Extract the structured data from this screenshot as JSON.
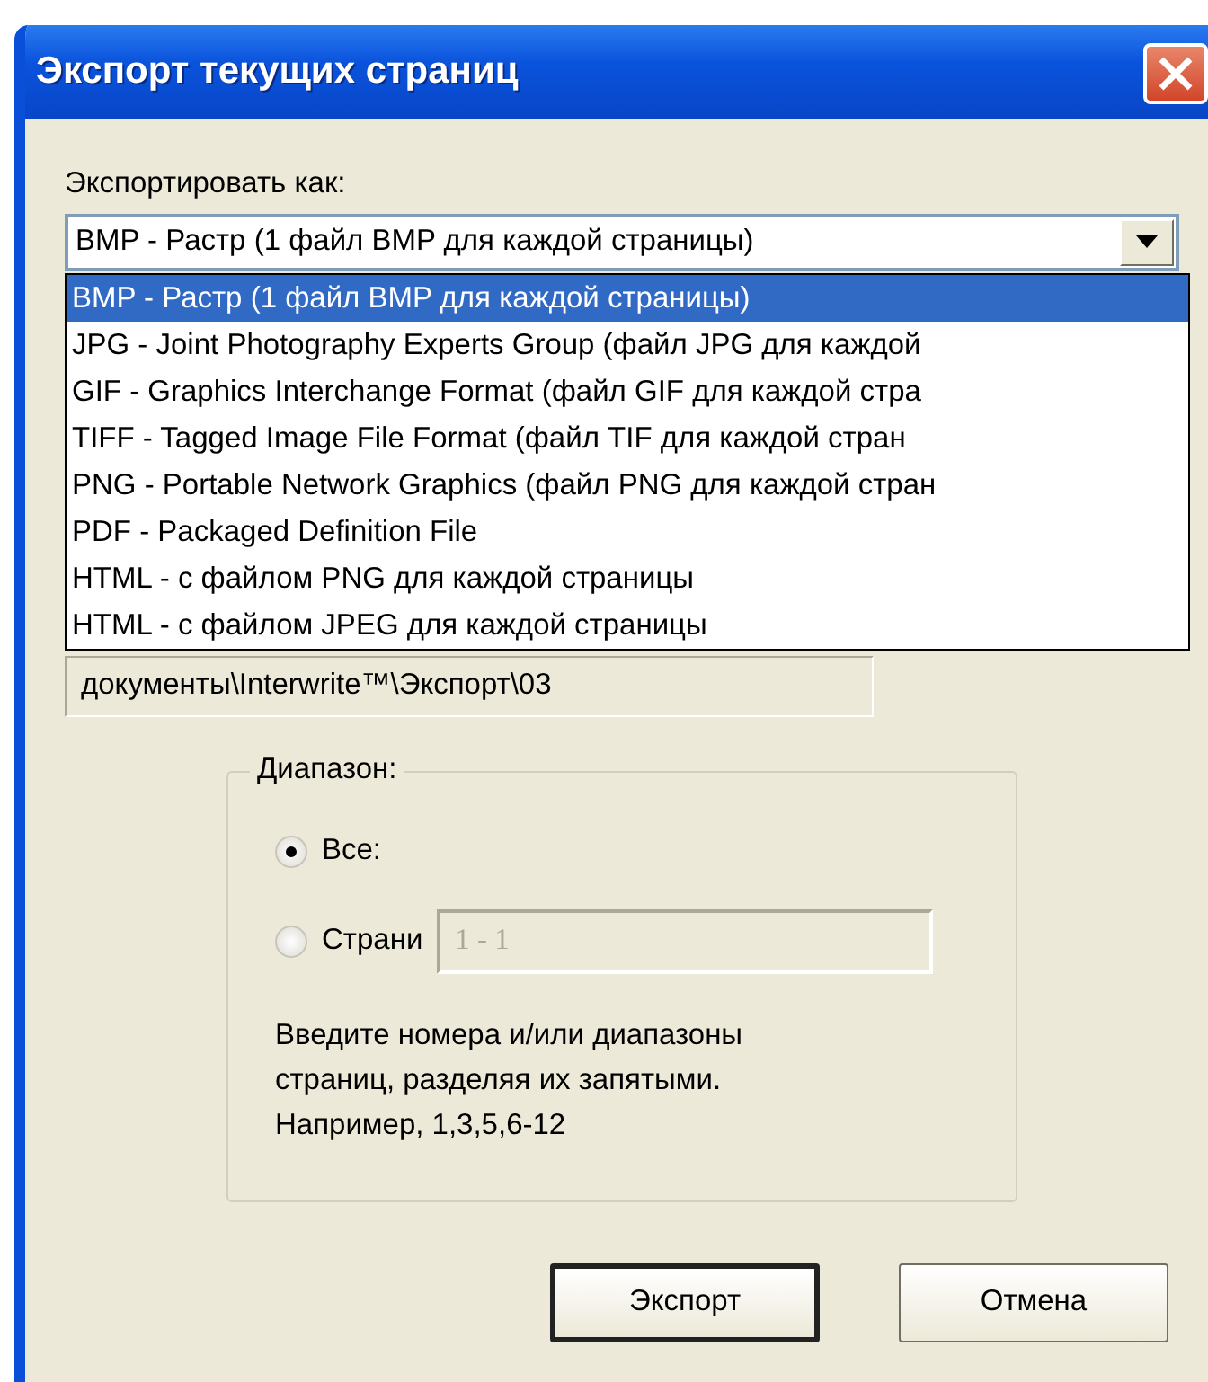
{
  "window": {
    "title": "Экспорт текущих страниц"
  },
  "export_as": {
    "label": "Экспортировать как:",
    "value": "BMP - Растр (1 файл BMP для каждой страницы)",
    "options": [
      {
        "label": "BMP - Растр (1 файл BMP для каждой страницы)",
        "selected": true
      },
      {
        "label": "JPG - Joint Photography Experts Group (файл JPG для каждой",
        "selected": false
      },
      {
        "label": "GIF - Graphics Interchange Format (файл GIF для каждой стра",
        "selected": false
      },
      {
        "label": "TIFF - Tagged Image File Format (файл TIF для каждой стран",
        "selected": false
      },
      {
        "label": "PNG - Portable Network Graphics (файл PNG для каждой стран",
        "selected": false
      },
      {
        "label": "PDF - Packaged Definition File",
        "selected": false
      },
      {
        "label": "HTML - с файлом PNG для каждой страницы",
        "selected": false
      },
      {
        "label": "HTML - с файлом JPEG для каждой страницы",
        "selected": false
      }
    ]
  },
  "path_field": {
    "value": "документы\\Interwrite™\\Экспорт\\03"
  },
  "range": {
    "legend": "Диапазон:",
    "options": [
      {
        "label": "Все:",
        "selected": true
      },
      {
        "label": "Страни",
        "selected": false
      }
    ],
    "pages_field": {
      "value": "1 - 1",
      "disabled": true
    },
    "hint": [
      "Введите номера и/или диапазоны",
      "страниц, разделяя их запятыми.",
      "Например, 1,3,5,6-12"
    ]
  },
  "buttons": [
    {
      "label": "Экспорт",
      "default": true
    },
    {
      "label": "Отмена",
      "default": false
    }
  ]
}
